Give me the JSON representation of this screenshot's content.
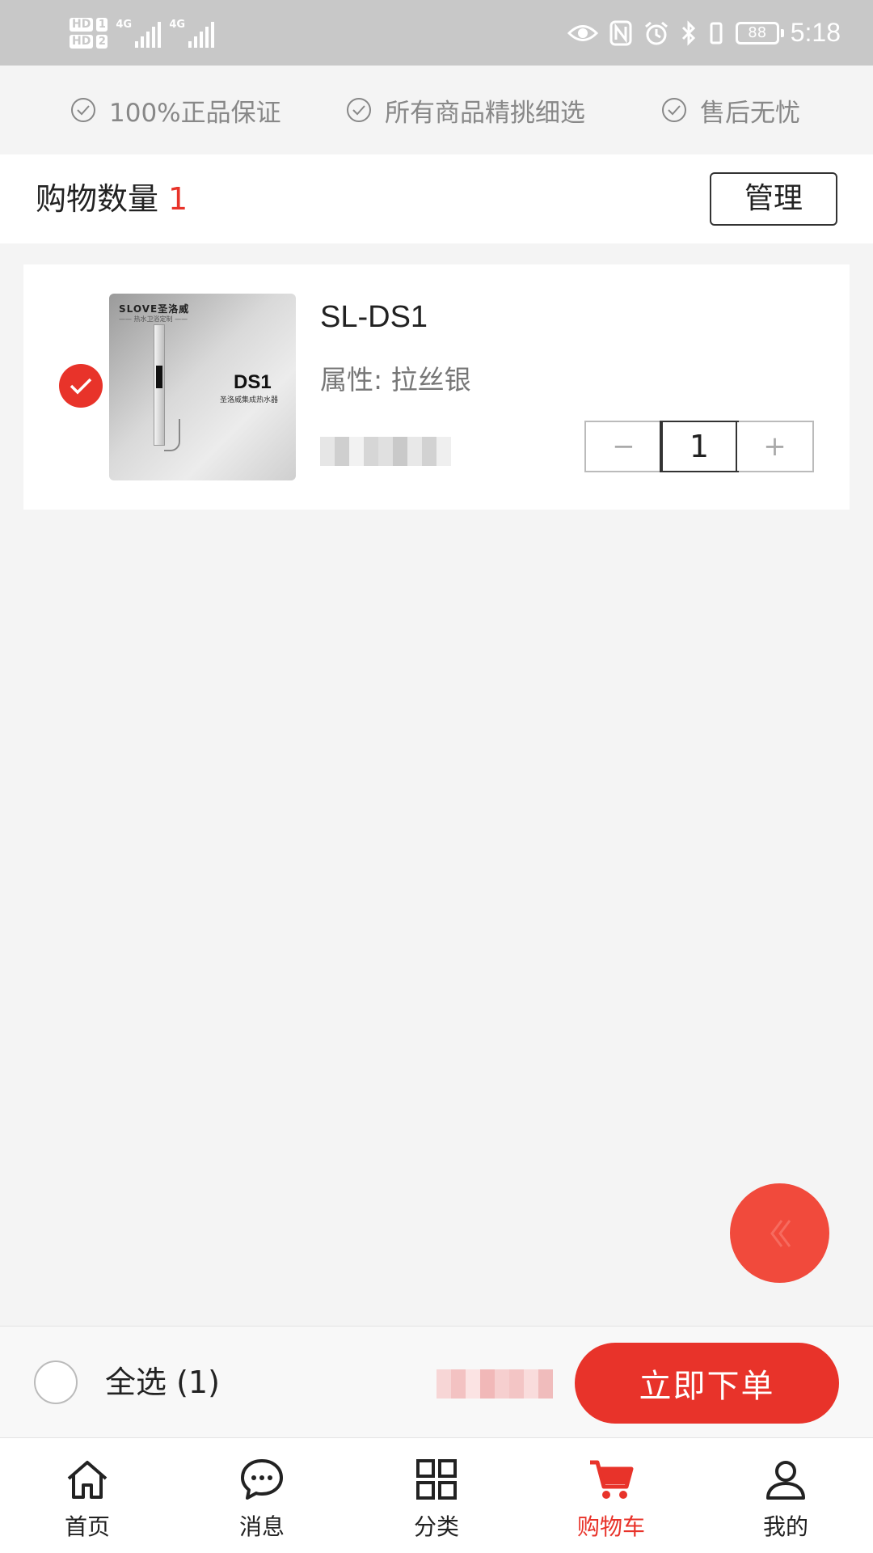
{
  "status_bar": {
    "hd1": "HD",
    "hd1_slot": "1",
    "hd2": "HD",
    "hd2_slot": "2",
    "net1": "4G",
    "net2": "4G",
    "battery": "88",
    "time": "5:18"
  },
  "guarantees": [
    {
      "text": "100%正品保证",
      "icon": "check-circle-icon"
    },
    {
      "text": "所有商品精挑细选",
      "icon": "check-circle-icon"
    },
    {
      "text": "售后无忧",
      "icon": "check-circle-icon"
    }
  ],
  "header": {
    "count_label": "购物数量",
    "count": "1",
    "manage_label": "管理"
  },
  "cart_items": [
    {
      "name": "SL-DS1",
      "attribute": "属性: 拉丝银",
      "quantity": "1",
      "minus": "−",
      "plus": "+",
      "selected": true,
      "thumb": {
        "brand": "SLOVE圣洛威",
        "brand_sub": "—— 热水卫浴定制 ——",
        "model": "DS1",
        "model_sub": "圣洛威集成热水器"
      }
    }
  ],
  "checkout": {
    "select_all_label": "全选 (1)",
    "order_button": "立即下单"
  },
  "nav": [
    {
      "label": "首页",
      "icon": "home-icon",
      "active": false
    },
    {
      "label": "消息",
      "icon": "chat-icon",
      "active": false
    },
    {
      "label": "分类",
      "icon": "grid-icon",
      "active": false
    },
    {
      "label": "购物车",
      "icon": "cart-icon",
      "active": true
    },
    {
      "label": "我的",
      "icon": "user-icon",
      "active": false
    }
  ],
  "colors": {
    "accent": "#e8332a",
    "status_bar": "#c8c8c8",
    "page_bg": "#f4f4f4"
  }
}
